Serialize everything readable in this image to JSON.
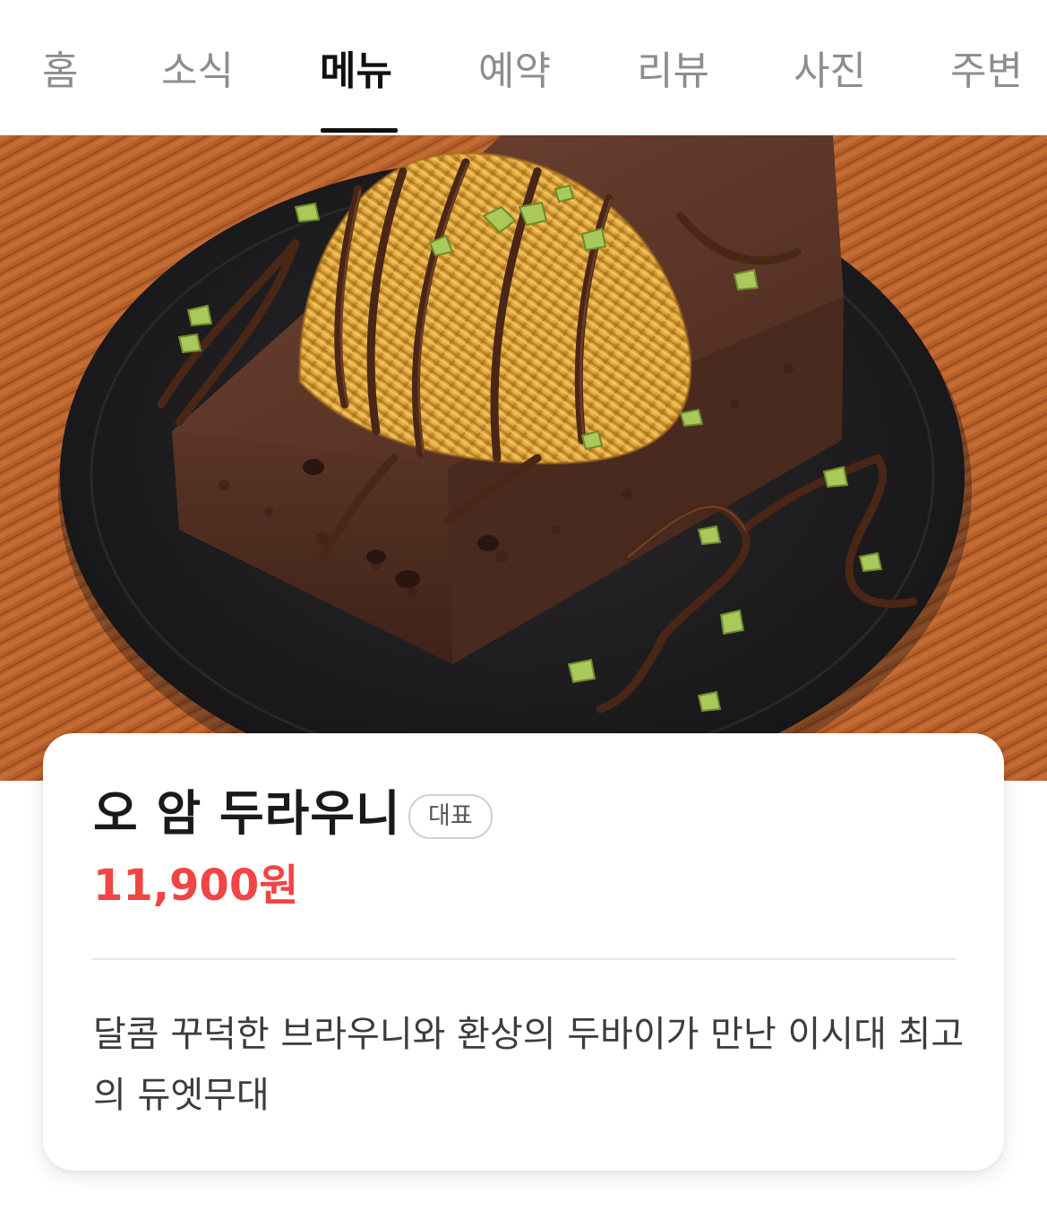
{
  "tabs": [
    {
      "label": "홈",
      "active": false
    },
    {
      "label": "소식",
      "active": false
    },
    {
      "label": "메뉴",
      "active": true
    },
    {
      "label": "예약",
      "active": false
    },
    {
      "label": "리뷰",
      "active": false
    },
    {
      "label": "사진",
      "active": false
    },
    {
      "label": "주변",
      "active": false
    }
  ],
  "menu_item": {
    "name": "오 암 두라우니",
    "badge": "대표",
    "price": "11,900원",
    "description": "달콤 꾸덕한 브라우니와 환상의 두바이가 만난 이시대 최고의 듀엣무대"
  },
  "colors": {
    "price": "#f24444",
    "active_tab": "#111111",
    "inactive_tab": "#8d8d8d",
    "background_table": "#b8622c",
    "plate": "#1e1d1f",
    "brownie": "#5a3424",
    "topping": "#d9a43c"
  }
}
